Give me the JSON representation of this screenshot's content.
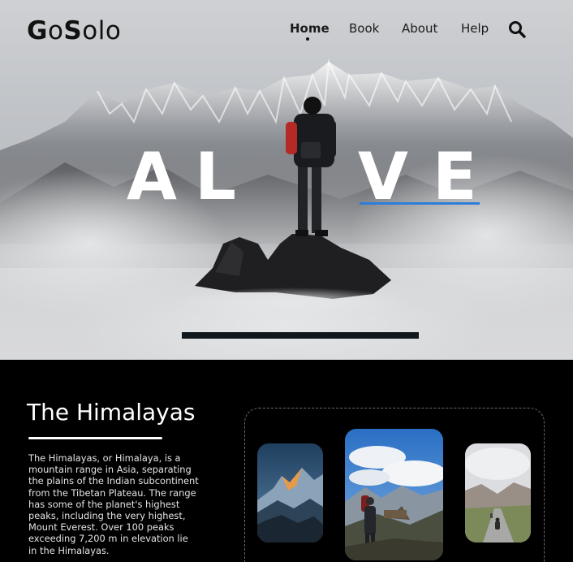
{
  "header": {
    "logo_prefix_bold": "G",
    "logo_o": "o",
    "logo_s_bold": "S",
    "logo_rest": "olo",
    "nav": [
      {
        "label": "Home",
        "active": true
      },
      {
        "label": "Book"
      },
      {
        "label": "About"
      },
      {
        "label": "Help"
      }
    ],
    "search_icon": "search-icon"
  },
  "hero": {
    "letters": [
      "A",
      "L",
      "V",
      "E"
    ],
    "accent": "#2f7dd8"
  },
  "section": {
    "title": "The Himalayas",
    "description": "The Himalayas, or Himalaya, is a mountain range in Asia, separating the plains of the Indian subcontinent from the Tibetan Plateau. The range has some of the planet's highest peaks, including the very highest, Mount Everest. Over 100 peaks exceeding 7,200 m in elevation lie in the Himalayas.",
    "gallery": [
      "sunset-peak-photo",
      "hiker-photo",
      "road-rider-photo"
    ]
  }
}
